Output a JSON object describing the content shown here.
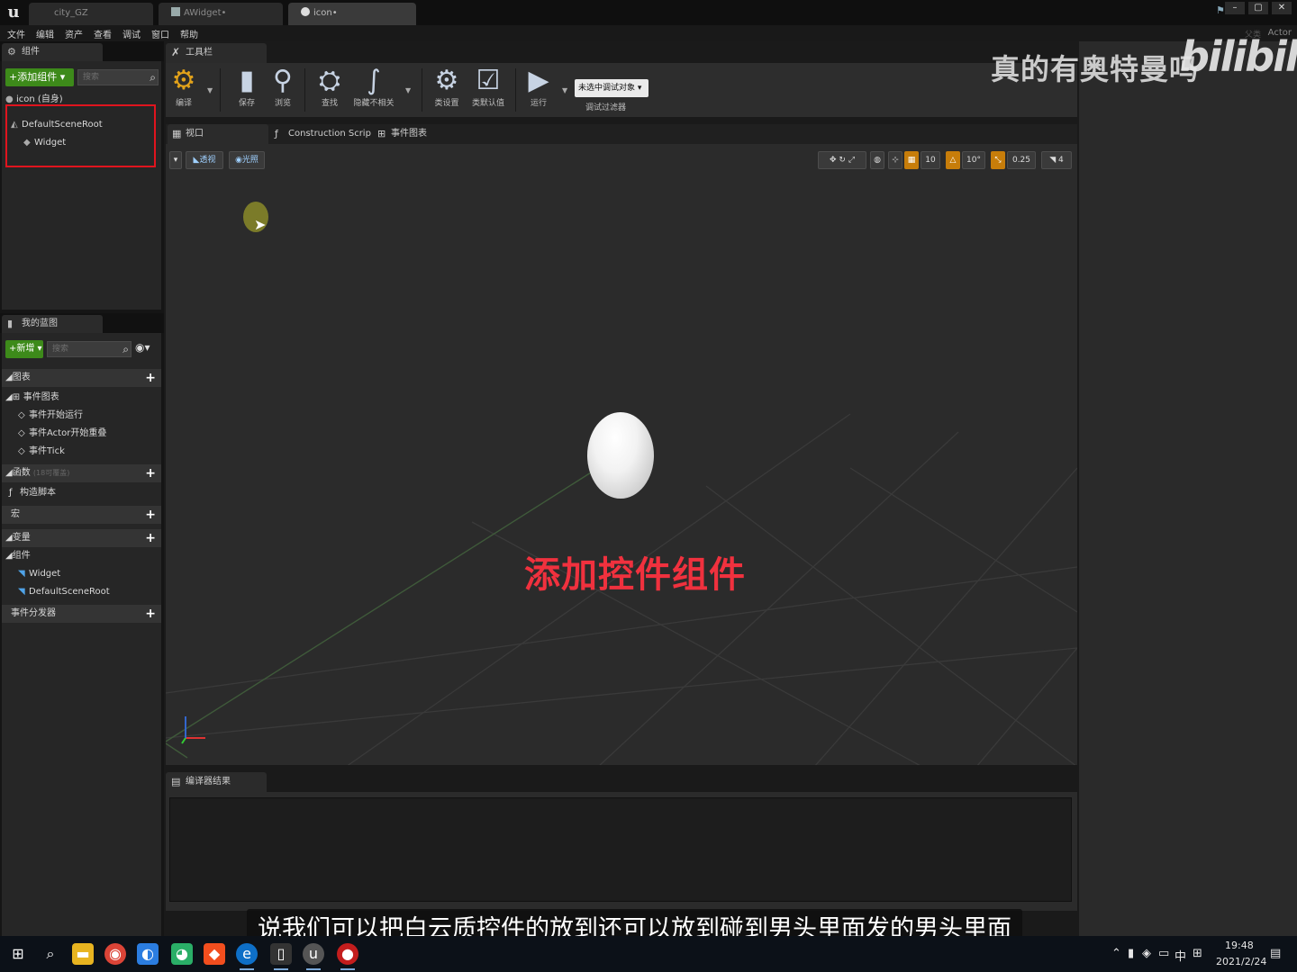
{
  "window": {
    "tabs": [
      {
        "label": "city_GZ"
      },
      {
        "label": "AWidget•"
      },
      {
        "label": "icon•"
      }
    ],
    "actor_label": "Actor",
    "parent_label": "父类"
  },
  "menu": [
    "文件",
    "编辑",
    "资产",
    "查看",
    "调试",
    "窗口",
    "帮助"
  ],
  "components_panel": {
    "tab_label": "组件",
    "add_button": "+添加组件 ▾",
    "search_placeholder": "搜索",
    "self_label": "icon (自身)",
    "tree": [
      {
        "label": "DefaultSceneRoot"
      },
      {
        "label": "Widget"
      }
    ]
  },
  "my_blueprint": {
    "tab_label": "我的蓝图",
    "new_button": "+新增 ▾",
    "search_placeholder": "搜索",
    "sections": {
      "graphs": "图表",
      "event_graph": "事件图表",
      "events": [
        "事件开始运行",
        "事件Actor开始重叠",
        "事件Tick"
      ],
      "functions": "函数",
      "functions_note": "(18可覆盖)",
      "construction": "构造脚本",
      "macros": "宏",
      "variables": "变量",
      "components": "组件",
      "component_items": [
        "Widget",
        "DefaultSceneRoot"
      ],
      "dispatchers": "事件分发器"
    }
  },
  "toolbar": {
    "tab_label": "工具栏",
    "buttons": [
      {
        "label": "编译",
        "icon": "compile-icon"
      },
      {
        "label": "保存",
        "icon": "save-icon"
      },
      {
        "label": "浏览",
        "icon": "browse-icon"
      },
      {
        "label": "查找",
        "icon": "find-icon"
      },
      {
        "label": "隐藏不相关",
        "icon": "hide-unrelated-icon"
      },
      {
        "label": "类设置",
        "icon": "class-settings-icon"
      },
      {
        "label": "类默认值",
        "icon": "class-defaults-icon"
      },
      {
        "label": "运行",
        "icon": "play-icon"
      }
    ],
    "debug_object": "未选中调试对象 ▾",
    "debug_filter": "调试过滤器"
  },
  "editor_tabs": [
    {
      "label": "视口"
    },
    {
      "label": "Construction Scrip"
    },
    {
      "label": "事件图表"
    }
  ],
  "viewport": {
    "perspective": "透视",
    "lit": "光照",
    "grid_snap": "10",
    "rotation_snap": "10°",
    "scale_snap": "0.25",
    "camera_speed": "4",
    "caption": "添加控件组件"
  },
  "compiler_results": {
    "tab_label": "编译器结果"
  },
  "overlay": {
    "watermark_text": "真的有奥特曼吗",
    "watermark_logo": "bilibili",
    "subtitle": "说我们可以把白云质控件的放到还可以放到碰到男头里面发的男头里面"
  },
  "taskbar": {
    "ime": "中",
    "time": "19:48",
    "date": "2021/2/24"
  },
  "colors": {
    "accent_green": "#3d8a1a",
    "highlight_red": "#e0141e",
    "caption_red": "#f0313e",
    "snap_orange": "#c77d0a"
  }
}
